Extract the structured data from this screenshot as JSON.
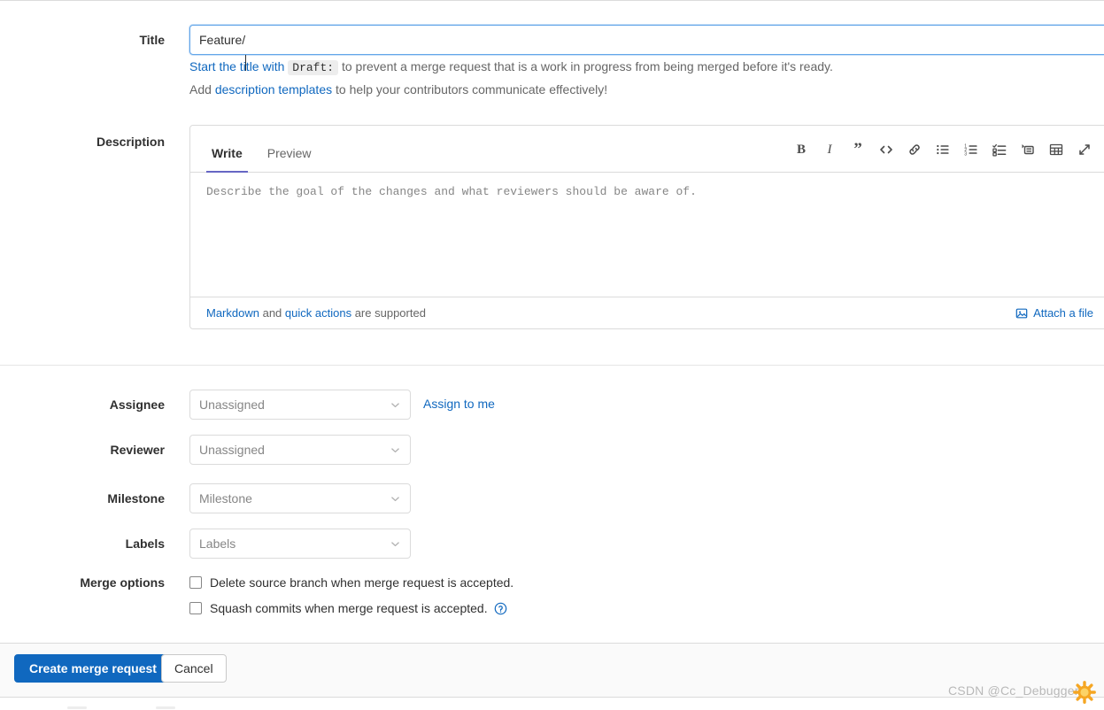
{
  "title_field": {
    "label": "Title",
    "value": "Feature/",
    "placeholder": ""
  },
  "help": {
    "draft_prefix": "Start the title with",
    "draft_code": "Draft:",
    "draft_suffix": "to prevent a merge request that is a work in progress from being merged before it's ready.",
    "templates_prefix": "Add",
    "templates_link": "description templates",
    "templates_suffix": "to help your contributors communicate effectively!"
  },
  "description": {
    "label": "Description",
    "tabs": [
      {
        "label": "Write",
        "active": true
      },
      {
        "label": "Preview",
        "active": false
      }
    ],
    "placeholder": "Describe the goal of the changes and what reviewers should be aware of.",
    "toolbar": [
      {
        "name": "bold-icon",
        "title": "Bold"
      },
      {
        "name": "italic-icon",
        "title": "Italic"
      },
      {
        "name": "quote-icon",
        "title": "Insert a quote"
      },
      {
        "name": "code-icon",
        "title": "Insert code"
      },
      {
        "name": "link-icon",
        "title": "Insert a link"
      },
      {
        "name": "bullet-list-icon",
        "title": "Add a bullet list"
      },
      {
        "name": "numbered-list-icon",
        "title": "Add a numbered list"
      },
      {
        "name": "task-list-icon",
        "title": "Add a checklist"
      },
      {
        "name": "collapsible-section-icon",
        "title": "Add a collapsible section"
      },
      {
        "name": "table-icon",
        "title": "Add a table"
      },
      {
        "name": "fullscreen-icon",
        "title": "Go full screen"
      }
    ],
    "footer": {
      "markdown_link": "Markdown",
      "and_text": "and",
      "quick_actions_link": "quick actions",
      "supported_text": "are supported",
      "attach_label": "Attach a file"
    }
  },
  "meta": {
    "assignee": {
      "label": "Assignee",
      "value": "Unassigned",
      "assign_to_me": "Assign to me"
    },
    "reviewer": {
      "label": "Reviewer",
      "value": "Unassigned"
    },
    "milestone": {
      "label": "Milestone",
      "value": "Milestone"
    },
    "labels": {
      "label": "Labels",
      "value": "Labels"
    }
  },
  "merge_options": {
    "label": "Merge options",
    "items": [
      {
        "text": "Delete source branch when merge request is accepted.",
        "checked": false,
        "has_help": false
      },
      {
        "text": "Squash commits when merge request is accepted.",
        "checked": false,
        "has_help": true
      }
    ]
  },
  "actions": {
    "submit_label": "Create merge request",
    "cancel_label": "Cancel"
  },
  "watermark": {
    "text": "CSDN @Cc_Debugger"
  },
  "colors": {
    "accent_blue": "#1068bf",
    "focus_blue": "#63a6e9",
    "tab_underline": "#6666c4",
    "border": "#dbdbdb",
    "muted_text": "#868686"
  }
}
